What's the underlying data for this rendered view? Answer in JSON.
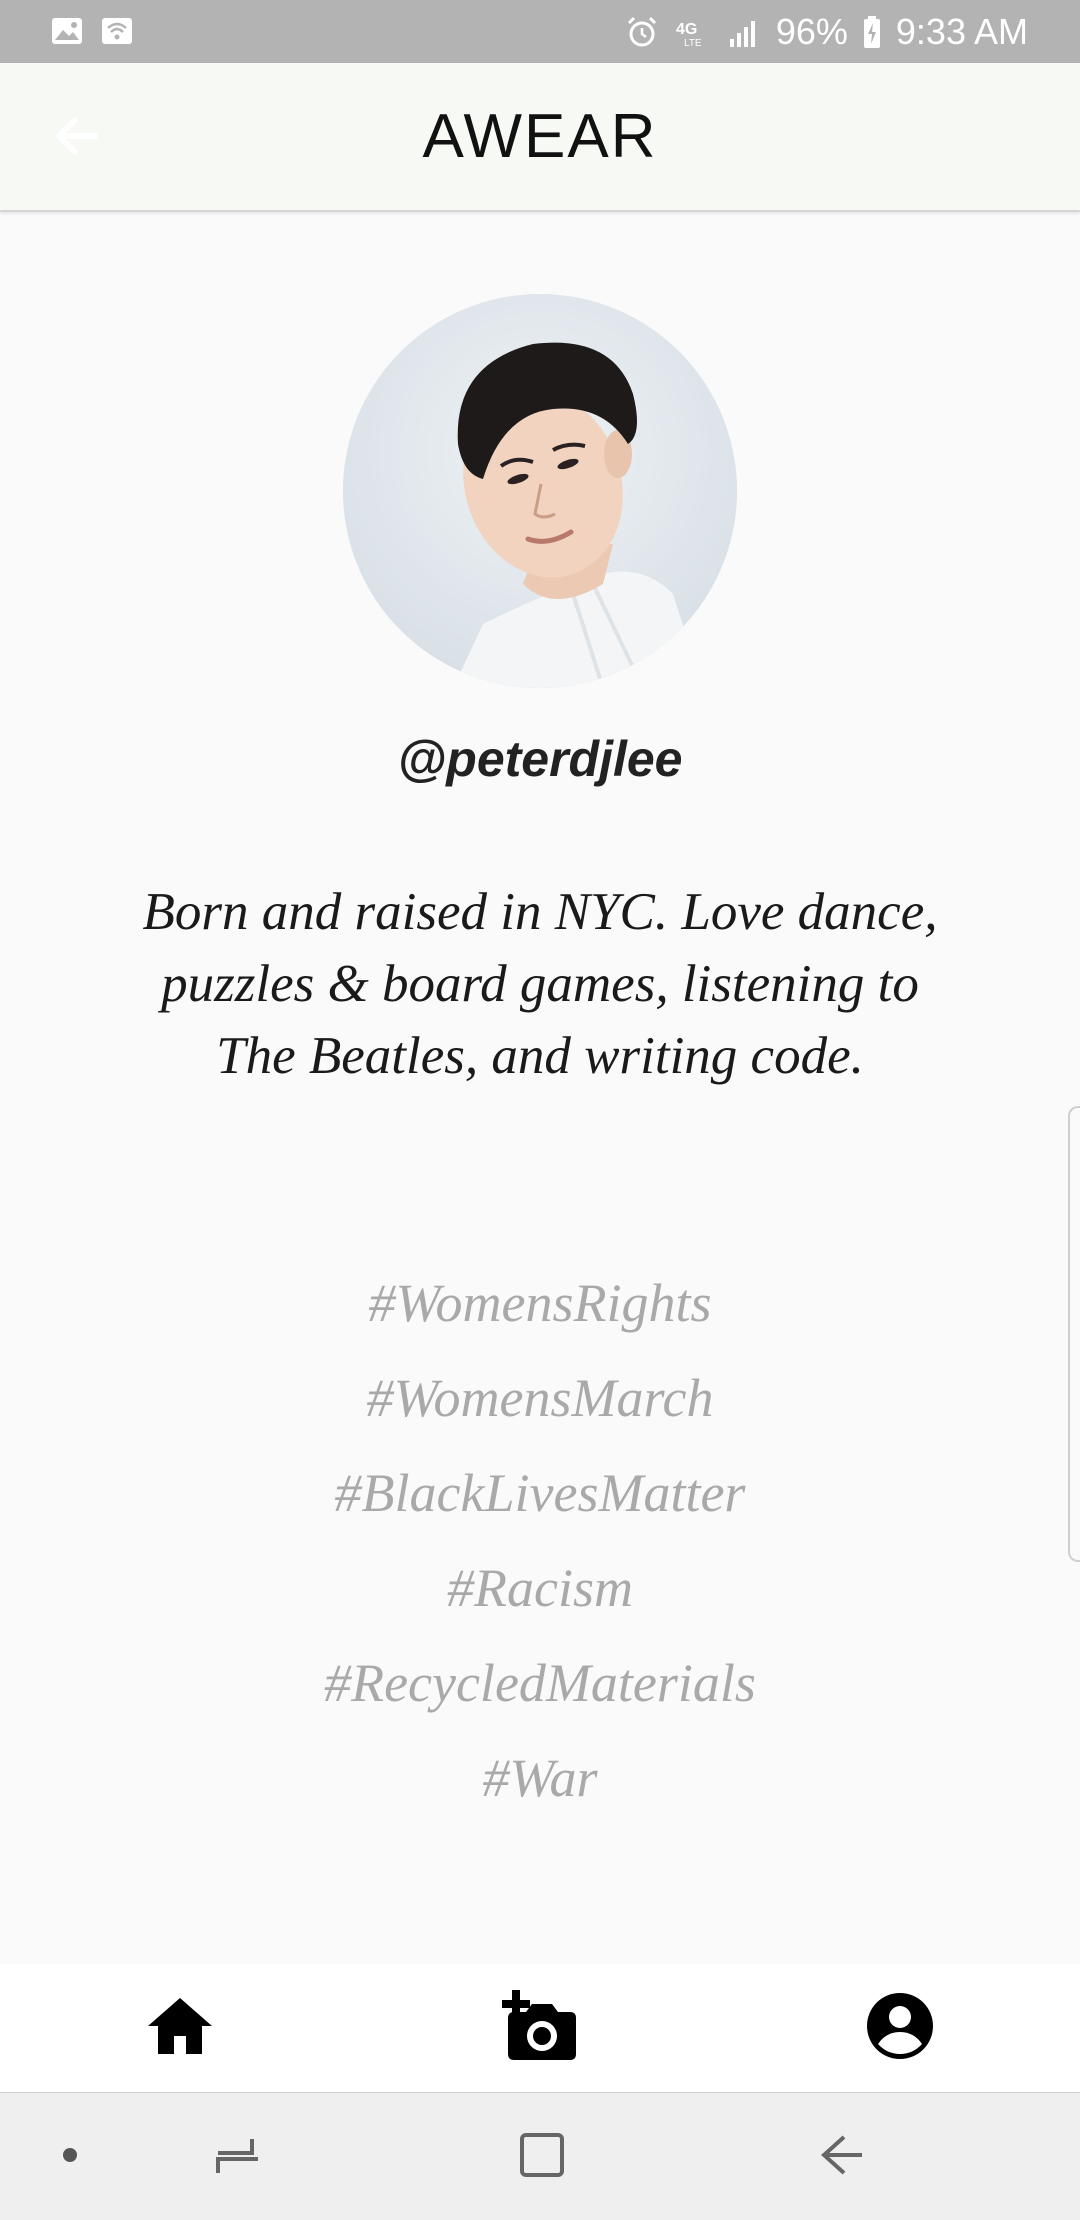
{
  "status_bar": {
    "battery": "96%",
    "time": "9:33 AM",
    "icons": [
      "image-icon",
      "wifi-calling-icon",
      "alarm-icon",
      "4g-lte-icon",
      "signal-icon",
      "battery-charging-icon"
    ]
  },
  "app_bar": {
    "title": "AWEAR",
    "back_icon": "arrow-left-icon"
  },
  "profile": {
    "username": "@peterdjlee",
    "bio": "Born and raised in NYC. Love dance, puzzles & board games, listening to The Beatles, and writing code.",
    "hashtags": [
      "#WomensRights",
      "#WomensMarch",
      "#BlackLivesMatter",
      "#Racism",
      "#RecycledMaterials",
      "#War"
    ]
  },
  "bottom_nav": {
    "items": [
      "home-icon",
      "add-photo-icon",
      "account-icon"
    ]
  },
  "system_nav": {
    "items": [
      "dot-icon",
      "recent-apps-icon",
      "home-square-icon",
      "back-icon"
    ]
  },
  "colors": {
    "status_bar": "#b3b3b3",
    "app_bar": "#f7f9f5",
    "page_bg": "#fafafa",
    "hashtag": "#a9a9a9",
    "text": "#1a1a1a"
  }
}
